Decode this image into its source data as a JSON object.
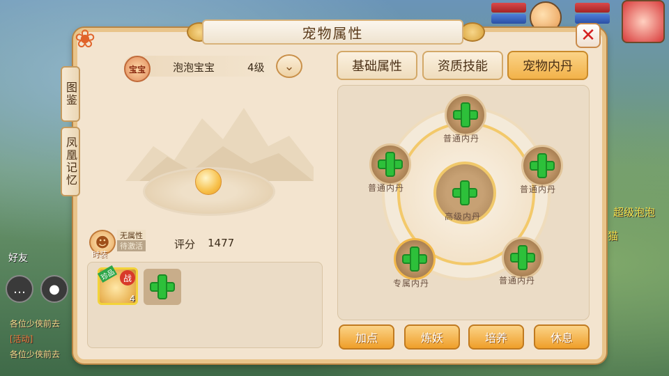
{
  "background": {
    "chat_lines": [
      "各位少侠前去",
      "[活动]",
      "各位少侠前去"
    ],
    "friend_label": "好友",
    "side_texts": [
      "超级泡泡",
      "猫"
    ]
  },
  "window": {
    "title": "宠物属性"
  },
  "side_tabs": [
    "图鉴",
    "凤凰记忆"
  ],
  "pet": {
    "badge": "宝宝",
    "name": "泡泡宝宝",
    "level": "4级",
    "attribute": "无属性",
    "status": "待激活",
    "costume_label": "时装",
    "score_label": "评分",
    "score_value": "1477",
    "slot_badge": "珍品",
    "slot_fight": "战",
    "slot_count": "4"
  },
  "tabs": [
    {
      "label": "基础属性",
      "active": false
    },
    {
      "label": "资质技能",
      "active": false
    },
    {
      "label": "宠物内丹",
      "active": true
    }
  ],
  "cores": {
    "top": "普通内丹",
    "left": "普通内丹",
    "right": "普通内丹",
    "center": "高级内丹",
    "bottom_left": "专属内丹",
    "bottom_right": "普通内丹"
  },
  "actions": [
    "加点",
    "炼妖",
    "培养",
    "休息"
  ],
  "colors": {
    "accent": "#f2b24a",
    "plus_green": "#2dc03a",
    "close_red": "#d42020"
  }
}
